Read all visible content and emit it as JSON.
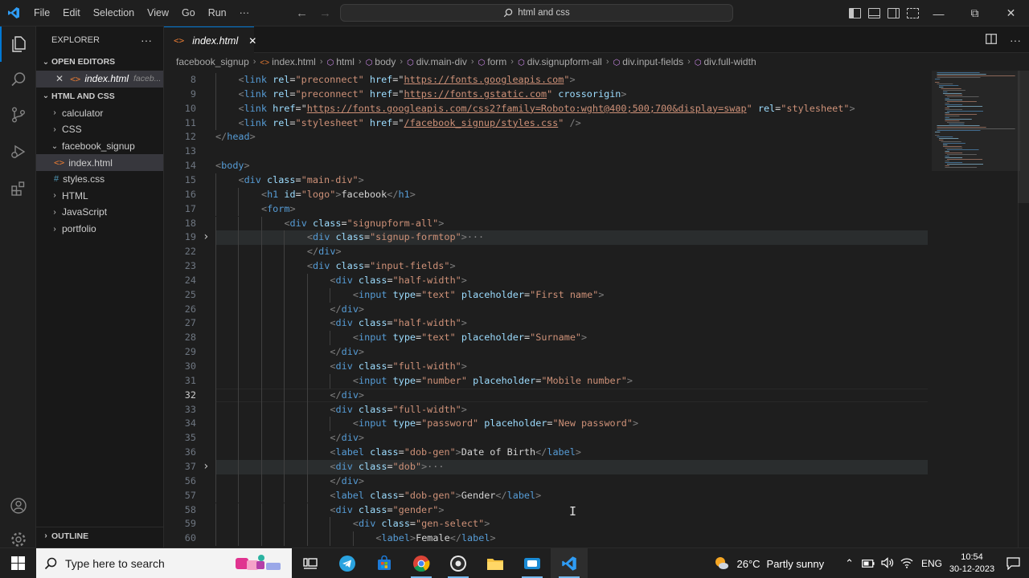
{
  "menu": [
    "File",
    "Edit",
    "Selection",
    "View",
    "Go",
    "Run",
    "···"
  ],
  "command_center": {
    "text": "html and css"
  },
  "explorer": {
    "title": "EXPLORER",
    "more": "···",
    "open_editors_label": "OPEN EDITORS",
    "open_editor": {
      "name": "index.html",
      "folder": "faceb..."
    },
    "workspace_label": "HTML AND CSS",
    "tree": [
      {
        "label": "calculator",
        "type": "folder",
        "open": false
      },
      {
        "label": "CSS",
        "type": "folder",
        "open": false
      },
      {
        "label": "facebook_signup",
        "type": "folder",
        "open": true
      },
      {
        "label": "index.html",
        "type": "html",
        "selected": true
      },
      {
        "label": "styles.css",
        "type": "css"
      },
      {
        "label": "HTML",
        "type": "folder",
        "open": false
      },
      {
        "label": "JavaScript",
        "type": "folder",
        "open": false
      },
      {
        "label": "portfolio",
        "type": "folder",
        "open": false
      }
    ],
    "outline_label": "OUTLINE"
  },
  "tab": {
    "label": "index.html"
  },
  "breadcrumb": [
    "facebook_signup",
    "index.html",
    "html",
    "body",
    "div.main-div",
    "form",
    "div.signupform-all",
    "div.input-fields",
    "div.full-width"
  ],
  "code_lines": [
    {
      "n": "8",
      "i": 1,
      "code": [
        [
          "t-br",
          "<"
        ],
        [
          "t-tag",
          "link "
        ],
        [
          "t-at",
          "rel"
        ],
        [
          "t-tx",
          "="
        ],
        [
          "t-st",
          "\"preconnect\" "
        ],
        [
          "t-at",
          "href"
        ],
        [
          "t-tx",
          "=\""
        ],
        [
          "t-url",
          "https://fonts.googleapis.com"
        ],
        [
          "t-st",
          "\""
        ],
        [
          "t-br",
          ">"
        ]
      ]
    },
    {
      "n": "9",
      "i": 1,
      "code": [
        [
          "t-br",
          "<"
        ],
        [
          "t-tag",
          "link "
        ],
        [
          "t-at",
          "rel"
        ],
        [
          "t-tx",
          "="
        ],
        [
          "t-st",
          "\"preconnect\" "
        ],
        [
          "t-at",
          "href"
        ],
        [
          "t-tx",
          "=\""
        ],
        [
          "t-url",
          "https://fonts.gstatic.com"
        ],
        [
          "t-st",
          "\" "
        ],
        [
          "t-at",
          "crossorigin"
        ],
        [
          "t-br",
          ">"
        ]
      ]
    },
    {
      "n": "10",
      "i": 1,
      "code": [
        [
          "t-br",
          "<"
        ],
        [
          "t-tag",
          "link "
        ],
        [
          "t-at",
          "href"
        ],
        [
          "t-tx",
          "=\""
        ],
        [
          "t-url",
          "https://fonts.googleapis.com/css2?family=Roboto:wght@400;500;700&display=swap"
        ],
        [
          "t-st",
          "\" "
        ],
        [
          "t-at",
          "rel"
        ],
        [
          "t-tx",
          "="
        ],
        [
          "t-st",
          "\"stylesheet\""
        ],
        [
          "t-br",
          ">"
        ]
      ]
    },
    {
      "n": "11",
      "i": 1,
      "code": [
        [
          "t-br",
          "<"
        ],
        [
          "t-tag",
          "link "
        ],
        [
          "t-at",
          "rel"
        ],
        [
          "t-tx",
          "="
        ],
        [
          "t-st",
          "\"stylesheet\" "
        ],
        [
          "t-at",
          "href"
        ],
        [
          "t-tx",
          "=\""
        ],
        [
          "t-url",
          "/facebook_signup/styles.css"
        ],
        [
          "t-st",
          "\" "
        ],
        [
          "t-br",
          "/>"
        ]
      ]
    },
    {
      "n": "12",
      "i": 0,
      "code": [
        [
          "t-br",
          "</"
        ],
        [
          "t-tag",
          "head"
        ],
        [
          "t-br",
          ">"
        ]
      ]
    },
    {
      "n": "13",
      "i": 0,
      "code": []
    },
    {
      "n": "14",
      "i": 0,
      "code": [
        [
          "t-br",
          "<"
        ],
        [
          "t-tag",
          "body"
        ],
        [
          "t-br",
          ">"
        ]
      ]
    },
    {
      "n": "15",
      "i": 1,
      "code": [
        [
          "t-br",
          "<"
        ],
        [
          "t-tag",
          "div "
        ],
        [
          "t-at",
          "class"
        ],
        [
          "t-tx",
          "="
        ],
        [
          "t-st",
          "\"main-div\""
        ],
        [
          "t-br",
          ">"
        ]
      ]
    },
    {
      "n": "16",
      "i": 2,
      "code": [
        [
          "t-br",
          "<"
        ],
        [
          "t-tag",
          "h1 "
        ],
        [
          "t-at",
          "id"
        ],
        [
          "t-tx",
          "="
        ],
        [
          "t-st",
          "\"logo\""
        ],
        [
          "t-br",
          ">"
        ],
        [
          "t-tx",
          "facebook"
        ],
        [
          "t-br",
          "</"
        ],
        [
          "t-tag",
          "h1"
        ],
        [
          "t-br",
          ">"
        ]
      ]
    },
    {
      "n": "17",
      "i": 2,
      "code": [
        [
          "t-br",
          "<"
        ],
        [
          "t-tag",
          "form"
        ],
        [
          "t-br",
          ">"
        ]
      ]
    },
    {
      "n": "18",
      "i": 3,
      "code": [
        [
          "t-br",
          "<"
        ],
        [
          "t-tag",
          "div "
        ],
        [
          "t-at",
          "class"
        ],
        [
          "t-tx",
          "="
        ],
        [
          "t-st",
          "\"signupform-all\""
        ],
        [
          "t-br",
          ">"
        ]
      ]
    },
    {
      "n": "19",
      "i": 4,
      "fold": true,
      "hl": true,
      "code": [
        [
          "t-br",
          "<"
        ],
        [
          "t-tag",
          "div "
        ],
        [
          "t-at",
          "class"
        ],
        [
          "t-tx",
          "="
        ],
        [
          "t-st",
          "\"signup-formtop\""
        ],
        [
          "t-br",
          ">"
        ],
        [
          "t-el",
          "···"
        ]
      ]
    },
    {
      "n": "22",
      "i": 4,
      "code": [
        [
          "t-br",
          "</"
        ],
        [
          "t-tag",
          "div"
        ],
        [
          "t-br",
          ">"
        ]
      ]
    },
    {
      "n": "23",
      "i": 4,
      "code": [
        [
          "t-br",
          "<"
        ],
        [
          "t-tag",
          "div "
        ],
        [
          "t-at",
          "class"
        ],
        [
          "t-tx",
          "="
        ],
        [
          "t-st",
          "\"input-fields\""
        ],
        [
          "t-br",
          ">"
        ]
      ]
    },
    {
      "n": "24",
      "i": 5,
      "code": [
        [
          "t-br",
          "<"
        ],
        [
          "t-tag",
          "div "
        ],
        [
          "t-at",
          "class"
        ],
        [
          "t-tx",
          "="
        ],
        [
          "t-st",
          "\"half-width\""
        ],
        [
          "t-br",
          ">"
        ]
      ]
    },
    {
      "n": "25",
      "i": 6,
      "code": [
        [
          "t-br",
          "<"
        ],
        [
          "t-tag",
          "input "
        ],
        [
          "t-at",
          "type"
        ],
        [
          "t-tx",
          "="
        ],
        [
          "t-st",
          "\"text\" "
        ],
        [
          "t-at",
          "placeholder"
        ],
        [
          "t-tx",
          "="
        ],
        [
          "t-st",
          "\"First name\""
        ],
        [
          "t-br",
          ">"
        ]
      ]
    },
    {
      "n": "26",
      "i": 5,
      "code": [
        [
          "t-br",
          "</"
        ],
        [
          "t-tag",
          "div"
        ],
        [
          "t-br",
          ">"
        ]
      ]
    },
    {
      "n": "27",
      "i": 5,
      "code": [
        [
          "t-br",
          "<"
        ],
        [
          "t-tag",
          "div "
        ],
        [
          "t-at",
          "class"
        ],
        [
          "t-tx",
          "="
        ],
        [
          "t-st",
          "\"half-width\""
        ],
        [
          "t-br",
          ">"
        ]
      ]
    },
    {
      "n": "28",
      "i": 6,
      "code": [
        [
          "t-br",
          "<"
        ],
        [
          "t-tag",
          "input "
        ],
        [
          "t-at",
          "type"
        ],
        [
          "t-tx",
          "="
        ],
        [
          "t-st",
          "\"text\" "
        ],
        [
          "t-at",
          "placeholder"
        ],
        [
          "t-tx",
          "="
        ],
        [
          "t-st",
          "\"Surname\""
        ],
        [
          "t-br",
          ">"
        ]
      ]
    },
    {
      "n": "29",
      "i": 5,
      "code": [
        [
          "t-br",
          "</"
        ],
        [
          "t-tag",
          "div"
        ],
        [
          "t-br",
          ">"
        ]
      ]
    },
    {
      "n": "30",
      "i": 5,
      "code": [
        [
          "t-br",
          "<"
        ],
        [
          "t-tag",
          "div "
        ],
        [
          "t-at",
          "class"
        ],
        [
          "t-tx",
          "="
        ],
        [
          "t-st",
          "\"full-width\""
        ],
        [
          "t-br",
          ">"
        ]
      ]
    },
    {
      "n": "31",
      "i": 6,
      "code": [
        [
          "t-br",
          "<"
        ],
        [
          "t-tag",
          "input "
        ],
        [
          "t-at",
          "type"
        ],
        [
          "t-tx",
          "="
        ],
        [
          "t-st",
          "\"number\" "
        ],
        [
          "t-at",
          "placeholder"
        ],
        [
          "t-tx",
          "="
        ],
        [
          "t-st",
          "\"Mobile number\""
        ],
        [
          "t-br",
          ">"
        ]
      ]
    },
    {
      "n": "32",
      "i": 5,
      "cur": true,
      "code": [
        [
          "t-br",
          "</"
        ],
        [
          "t-tag",
          "div"
        ],
        [
          "t-br",
          ">"
        ]
      ]
    },
    {
      "n": "33",
      "i": 5,
      "code": [
        [
          "t-br",
          "<"
        ],
        [
          "t-tag",
          "div "
        ],
        [
          "t-at",
          "class"
        ],
        [
          "t-tx",
          "="
        ],
        [
          "t-st",
          "\"full-width\""
        ],
        [
          "t-br",
          ">"
        ]
      ]
    },
    {
      "n": "34",
      "i": 6,
      "code": [
        [
          "t-br",
          "<"
        ],
        [
          "t-tag",
          "input "
        ],
        [
          "t-at",
          "type"
        ],
        [
          "t-tx",
          "="
        ],
        [
          "t-st",
          "\"password\" "
        ],
        [
          "t-at",
          "placeholder"
        ],
        [
          "t-tx",
          "="
        ],
        [
          "t-st",
          "\"New password\""
        ],
        [
          "t-br",
          ">"
        ]
      ]
    },
    {
      "n": "35",
      "i": 5,
      "code": [
        [
          "t-br",
          "</"
        ],
        [
          "t-tag",
          "div"
        ],
        [
          "t-br",
          ">"
        ]
      ]
    },
    {
      "n": "36",
      "i": 5,
      "code": [
        [
          "t-br",
          "<"
        ],
        [
          "t-tag",
          "label "
        ],
        [
          "t-at",
          "class"
        ],
        [
          "t-tx",
          "="
        ],
        [
          "t-st",
          "\"dob-gen\""
        ],
        [
          "t-br",
          ">"
        ],
        [
          "t-tx",
          "Date of Birth"
        ],
        [
          "t-br",
          "</"
        ],
        [
          "t-tag",
          "label"
        ],
        [
          "t-br",
          ">"
        ]
      ]
    },
    {
      "n": "37",
      "i": 5,
      "fold": true,
      "hl": true,
      "code": [
        [
          "t-br",
          "<"
        ],
        [
          "t-tag",
          "div "
        ],
        [
          "t-at",
          "class"
        ],
        [
          "t-tx",
          "="
        ],
        [
          "t-st",
          "\"dob\""
        ],
        [
          "t-br",
          ">"
        ],
        [
          "t-el",
          "···"
        ]
      ]
    },
    {
      "n": "56",
      "i": 5,
      "code": [
        [
          "t-br",
          "</"
        ],
        [
          "t-tag",
          "div"
        ],
        [
          "t-br",
          ">"
        ]
      ]
    },
    {
      "n": "57",
      "i": 5,
      "code": [
        [
          "t-br",
          "<"
        ],
        [
          "t-tag",
          "label "
        ],
        [
          "t-at",
          "class"
        ],
        [
          "t-tx",
          "="
        ],
        [
          "t-st",
          "\"dob-gen\""
        ],
        [
          "t-br",
          ">"
        ],
        [
          "t-tx",
          "Gender"
        ],
        [
          "t-br",
          "</"
        ],
        [
          "t-tag",
          "label"
        ],
        [
          "t-br",
          ">"
        ]
      ]
    },
    {
      "n": "58",
      "i": 5,
      "code": [
        [
          "t-br",
          "<"
        ],
        [
          "t-tag",
          "div "
        ],
        [
          "t-at",
          "class"
        ],
        [
          "t-tx",
          "="
        ],
        [
          "t-st",
          "\"gender\""
        ],
        [
          "t-br",
          ">"
        ]
      ]
    },
    {
      "n": "59",
      "i": 6,
      "code": [
        [
          "t-br",
          "<"
        ],
        [
          "t-tag",
          "div "
        ],
        [
          "t-at",
          "class"
        ],
        [
          "t-tx",
          "="
        ],
        [
          "t-st",
          "\"gen-select\""
        ],
        [
          "t-br",
          ">"
        ]
      ]
    },
    {
      "n": "60",
      "i": 7,
      "code": [
        [
          "t-br",
          "<"
        ],
        [
          "t-tag",
          "label"
        ],
        [
          "t-br",
          ">"
        ],
        [
          "t-tx",
          "Female"
        ],
        [
          "t-br",
          "</"
        ],
        [
          "t-tag",
          "label"
        ],
        [
          "t-br",
          ">"
        ]
      ]
    }
  ],
  "taskbar": {
    "search_placeholder": "Type here to search",
    "weather": {
      "temp": "26°C",
      "condition": "Partly sunny"
    },
    "language": "ENG",
    "time": "10:54",
    "date": "30-12-2023"
  },
  "colors": {
    "accent": "#0078d4",
    "editor_bg": "#1e1e1e",
    "sidebar_bg": "#181818"
  }
}
